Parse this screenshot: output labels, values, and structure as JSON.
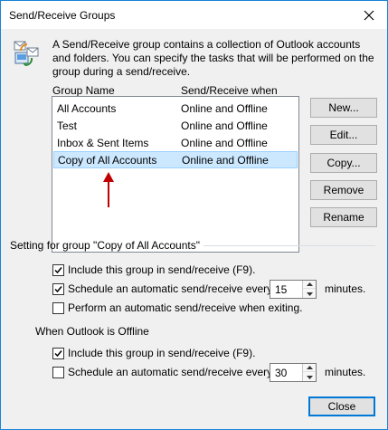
{
  "window": {
    "title": "Send/Receive Groups",
    "description": "A Send/Receive group contains a collection of Outlook accounts and folders. You can specify the tasks that will be performed on the group during a send/receive."
  },
  "list": {
    "columns": [
      "Group Name",
      "Send/Receive when"
    ],
    "rows": [
      {
        "name": "All Accounts",
        "when": "Online and Offline"
      },
      {
        "name": "Test",
        "when": "Online and Offline"
      },
      {
        "name": "Inbox & Sent Items",
        "when": "Online and Offline"
      },
      {
        "name": "Copy of All Accounts",
        "when": "Online and Offline"
      }
    ],
    "selected_index": 3
  },
  "buttons": {
    "new": "New...",
    "edit": "Edit...",
    "copy": "Copy...",
    "remove": "Remove",
    "rename": "Rename",
    "close": "Close"
  },
  "settings": {
    "group_label": "Setting for group \"Copy of All Accounts\"",
    "online": {
      "include_label": "Include this group in send/receive (F9).",
      "include_checked": true,
      "schedule_label": "Schedule an automatic send/receive every",
      "schedule_checked": true,
      "schedule_value": "15",
      "minutes_label": "minutes.",
      "exit_label": "Perform an automatic send/receive when exiting.",
      "exit_checked": false
    },
    "offline_label": "When Outlook is Offline",
    "offline": {
      "include_label": "Include this group in send/receive (F9).",
      "include_checked": true,
      "schedule_label": "Schedule an automatic send/receive every",
      "schedule_checked": false,
      "schedule_value": "30",
      "minutes_label": "minutes."
    }
  },
  "colors": {
    "accent": "#0078d7",
    "selection": "#cce8ff",
    "annotation_arrow": "#c00000"
  },
  "icons": {
    "app": "send-receive-groups-icon",
    "close": "close-icon",
    "annotation": "red-arrow-up-icon"
  }
}
